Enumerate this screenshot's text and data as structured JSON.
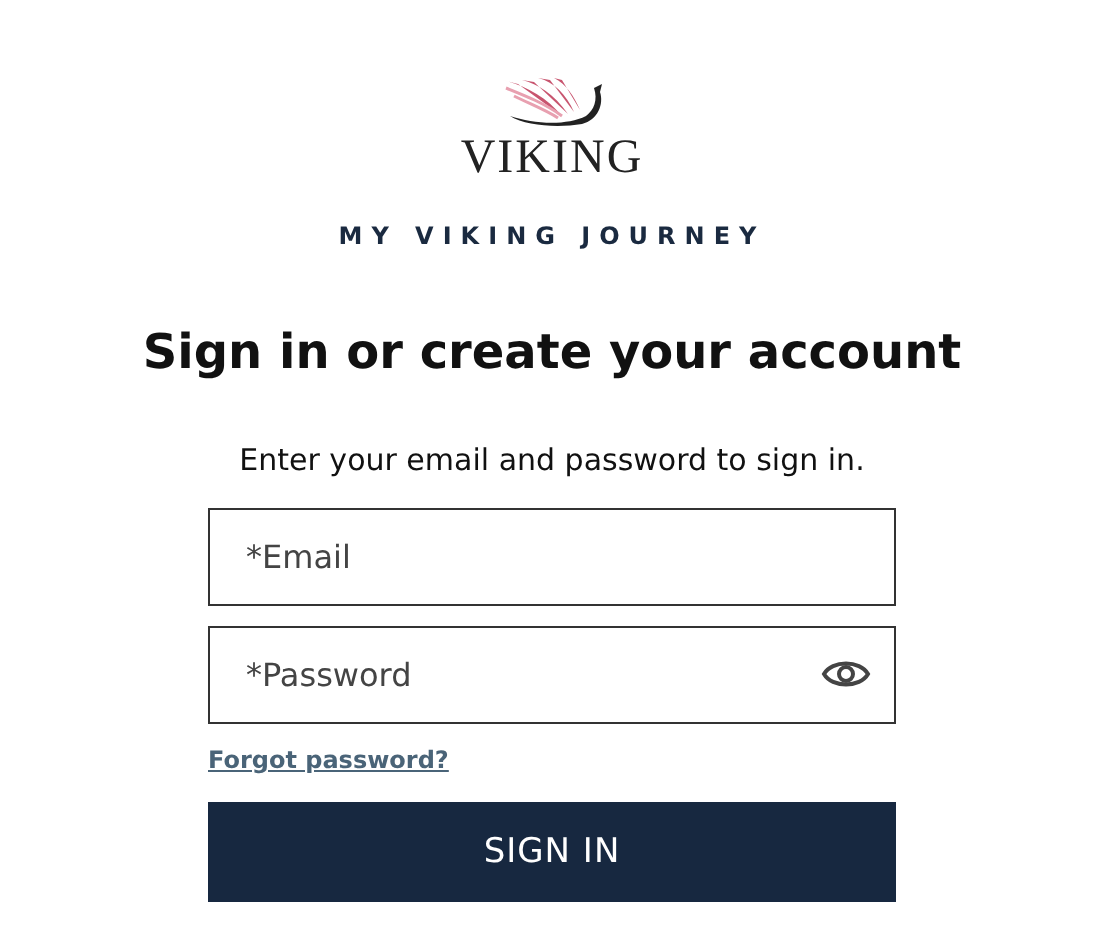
{
  "logo": {
    "wordmark": "VIKING"
  },
  "tagline": "MY VIKING JOURNEY",
  "heading": "Sign in or create your account",
  "instructions": "Enter your email and password to sign in.",
  "fields": [
    {
      "kind": "text",
      "placeholder": "*Email"
    },
    {
      "kind": "password",
      "placeholder": "*Password"
    }
  ],
  "forgot_link": "Forgot password?",
  "submit_button": "SIGN IN"
}
